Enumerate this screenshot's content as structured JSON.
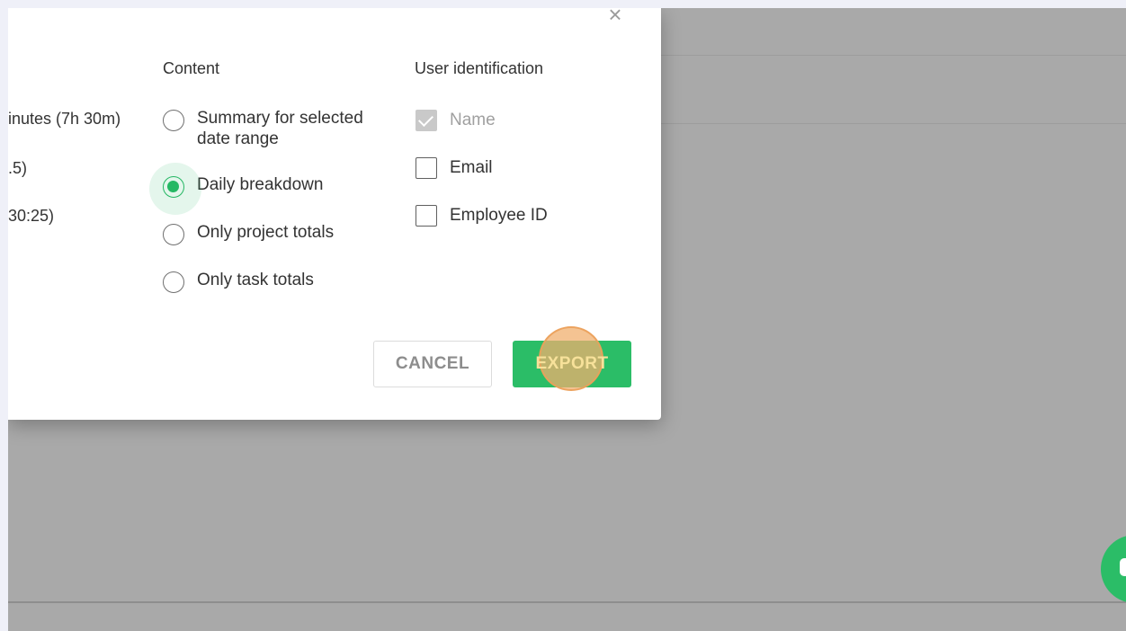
{
  "background": {
    "overlay_color": "#a9a9a9"
  },
  "dialog": {
    "close_icon": "×",
    "truncated_options": [
      "inutes (7h 30m)",
      ".5)",
      "30:25)"
    ],
    "content": {
      "heading": "Content",
      "options": [
        {
          "label_line1": "Summary for selected",
          "label_line2": "date range",
          "checked": false
        },
        {
          "label_line1": "Daily breakdown",
          "label_line2": "",
          "checked": true
        },
        {
          "label_line1": "Only project totals",
          "label_line2": "",
          "checked": false
        },
        {
          "label_line1": "Only task totals",
          "label_line2": "",
          "checked": false
        }
      ]
    },
    "user_identification": {
      "heading": "User identification",
      "options": [
        {
          "label": "Name",
          "checked": true,
          "disabled": true
        },
        {
          "label": "Email",
          "checked": false,
          "disabled": false
        },
        {
          "label": "Employee ID",
          "checked": false,
          "disabled": false
        }
      ]
    },
    "buttons": {
      "cancel": "CANCEL",
      "export": "EXPORT"
    }
  },
  "colors": {
    "accent": "#2bbd67",
    "click_marker": "#f0af6e"
  },
  "icons": {
    "close": "close-icon",
    "chat": "chat-icon"
  }
}
